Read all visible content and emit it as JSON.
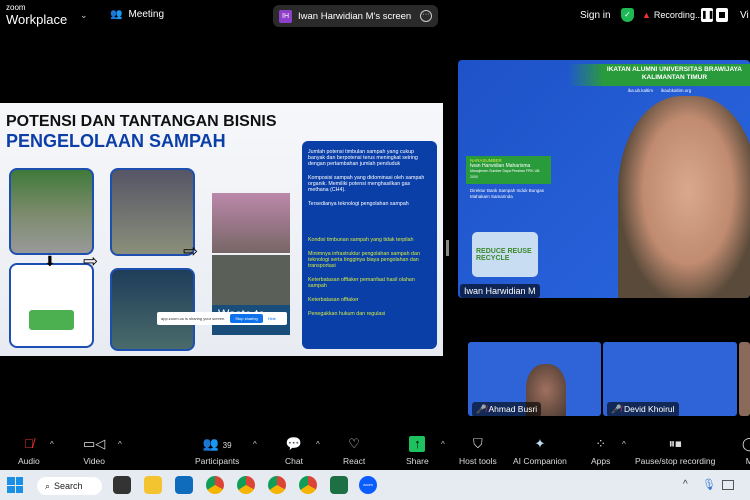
{
  "topbar": {
    "logo_small": "zoom",
    "logo_big": "Workplace",
    "meeting_label": "Meeting",
    "share_initials": "IH",
    "share_title": "Iwan Harwidian M's screen",
    "sign_in": "Sign in",
    "recording": "Recording...",
    "view": "Vi"
  },
  "slide": {
    "title_line1": "POTENSI DAN TANTANGAN BISNIS",
    "title_line2": "PENGELOLAAN SAMPAH",
    "waste_banner": "Waste to",
    "points_white": [
      "Jumlah potensi timbulan sampah yang cukup banyak dan berpotensi terus meningkat seiring dengan pertambahan jumlah penduduk",
      "Komposisi sampah yang didominasi oleh sampah organik. Memiliki potensi menghasilkan gas methana (CH4).",
      "Tersedianya teknologi pengolahan sampah"
    ],
    "points_yellow": [
      "Kondisi timbunan sampah yang tidak terpilah",
      "Minimnya infrastruktur pengolahan sampah dan teknologi serta tingginya biaya pengolahan dan transportasi",
      "Keterbatasan offtaker pemanfaat hasil olahan sampah",
      "Keterbatasan offtaker",
      "Penegakkan hukum dan regulasi"
    ],
    "sharing_notice": "app.zoom.us is sharing your screen.",
    "stop_sharing": "Stop sharing",
    "hide": "Hide"
  },
  "speaker": {
    "org_line1": "IKATAN ALUMNI UNIVERSITAS BRAWIJAYA",
    "org_line2": "KALIMANTAN TIMUR",
    "social1": "ika.ub.kaltim",
    "social2": "ikaubkaltim.org",
    "narasumber": "NARASUMBER",
    "speaker_full": "Iwan Harwidian Maharisma",
    "speaker_sub": "Manajemen Sumber Daya Perairan FPIK UB 2000",
    "role": "Direktur Bank Sampah Induk Bungas Mahakam Samarinda",
    "logo": "REDUCE REUSE RECYCLE",
    "name": "Iwan Harwidian M"
  },
  "thumbs": [
    {
      "name": "Ahmad Busri"
    },
    {
      "name": "Devid Khoirul"
    }
  ],
  "toolbar": {
    "participants_count": "39",
    "items": [
      "Audio",
      "Video",
      "Participants",
      "Chat",
      "React",
      "Share",
      "Host tools",
      "AI Companion",
      "Apps",
      "Pause/stop recording",
      "M"
    ]
  },
  "taskbar": {
    "search": "Search",
    "zoom_label": "zoom"
  },
  "colors": {
    "accent": "#0e72ed",
    "slide_blue": "#0a3fa8",
    "share_green": "#1ec15f"
  }
}
